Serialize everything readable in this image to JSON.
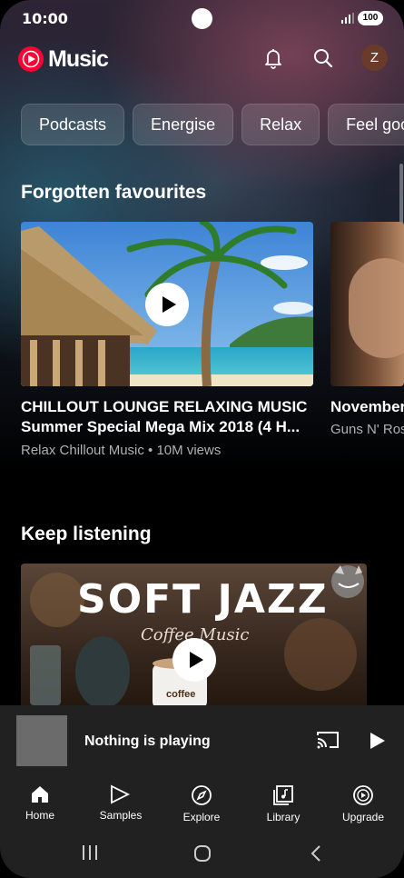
{
  "status": {
    "time": "10:00",
    "battery": "100"
  },
  "header": {
    "app_name": "Music",
    "avatar_letter": "Z"
  },
  "chips": [
    "Podcasts",
    "Energise",
    "Relax",
    "Feel goo"
  ],
  "sections": {
    "forgotten": {
      "title": "Forgotten favourites",
      "items": [
        {
          "title_line1": "CHILLOUT LOUNGE RELAXING MUSIC",
          "title_line2": "Summer Special Mega Mix 2018 (4 H...",
          "subtitle": "Relax Chillout Music • 10M views"
        },
        {
          "title_line1": "November",
          "subtitle": "Guns N' Ros"
        }
      ]
    },
    "keep_listening": {
      "title": "Keep listening",
      "items": [
        {
          "thumb_title": "SOFT JAZZ",
          "thumb_sub": "Coffee Music",
          "cup_label": "coffee"
        }
      ]
    }
  },
  "miniplayer": {
    "text": "Nothing is playing"
  },
  "nav": [
    {
      "label": "Home",
      "icon": "home-icon"
    },
    {
      "label": "Samples",
      "icon": "samples-icon"
    },
    {
      "label": "Explore",
      "icon": "compass-icon"
    },
    {
      "label": "Library",
      "icon": "library-icon"
    },
    {
      "label": "Upgrade",
      "icon": "upgrade-icon"
    }
  ],
  "colors": {
    "accent": "#ff0033",
    "bar": "#212121"
  }
}
